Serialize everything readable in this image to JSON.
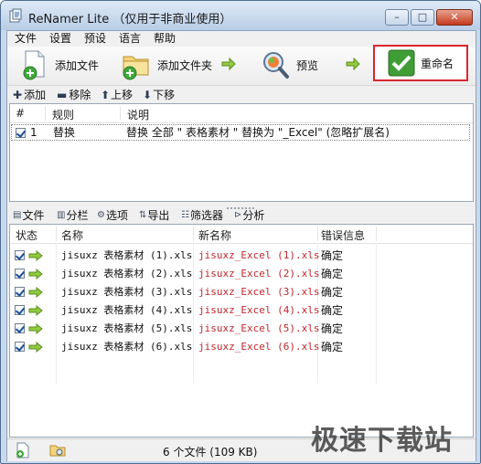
{
  "window": {
    "title": "ReNamer Lite （仅用于非商业使用）",
    "controls": {
      "minimize": "–",
      "maximize": "□",
      "close": "✕"
    }
  },
  "menu": [
    "文件",
    "设置",
    "预设",
    "语言",
    "帮助"
  ],
  "toolbar": {
    "add_files": "添加文件",
    "add_folder": "添加文件夹",
    "preview": "预览",
    "rename": "重命名",
    "accent": "#d9272e"
  },
  "rules_toolbar": {
    "add": "添加",
    "remove": "移除",
    "move_up": "上移",
    "move_down": "下移"
  },
  "rules": {
    "columns": [
      "#",
      "规则",
      "说明"
    ],
    "rows": [
      {
        "checked": true,
        "index": "1",
        "rule": "替换",
        "desc": "替换 全部 \" 表格素材 \" 替换为 \"_Excel\" (忽略扩展名)"
      }
    ]
  },
  "files_toolbar": {
    "files": "文件",
    "columns": "分栏",
    "options": "选项",
    "export": "导出",
    "filter": "筛选器",
    "analyze": "分析"
  },
  "files": {
    "columns": [
      "状态",
      "名称",
      "新名称",
      "错误信息"
    ],
    "rows": [
      {
        "name": "jisuxz 表格素材 (1).xls",
        "new_name": "jisuxz_Excel (1).xls",
        "error": "确定"
      },
      {
        "name": "jisuxz 表格素材 (2).xls",
        "new_name": "jisuxz_Excel (2).xls",
        "error": "确定"
      },
      {
        "name": "jisuxz 表格素材 (3).xls",
        "new_name": "jisuxz_Excel (3).xls",
        "error": "确定"
      },
      {
        "name": "jisuxz 表格素材 (4).xls",
        "new_name": "jisuxz_Excel (4).xls",
        "error": "确定"
      },
      {
        "name": "jisuxz 表格素材 (5).xls",
        "new_name": "jisuxz_Excel (5).xls",
        "error": "确定"
      },
      {
        "name": "jisuxz 表格素材 (6).xls",
        "new_name": "jisuxz_Excel (6).xls",
        "error": "确定"
      }
    ]
  },
  "status": {
    "summary": "6 个文件 (109 KB)"
  },
  "watermark": "极速下载站"
}
